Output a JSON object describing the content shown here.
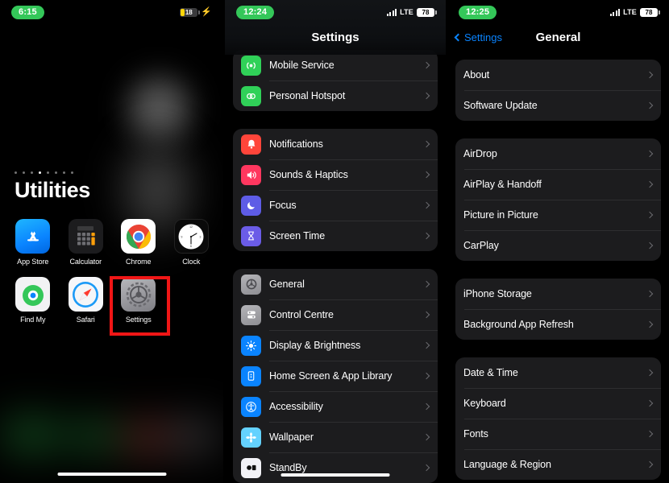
{
  "home": {
    "status": {
      "time": "6:15",
      "battery_percent": "18",
      "charging_icon": "lightning-bolt"
    },
    "folder_title": "Utilities",
    "page_dots": 8,
    "active_dot": 4,
    "apps": [
      {
        "label": "App Store",
        "icon": "app-store-icon"
      },
      {
        "label": "Calculator",
        "icon": "calculator-icon"
      },
      {
        "label": "Chrome",
        "icon": "chrome-icon"
      },
      {
        "label": "Clock",
        "icon": "clock-icon"
      },
      {
        "label": "Find My",
        "icon": "find-my-icon"
      },
      {
        "label": "Safari",
        "icon": "safari-icon"
      },
      {
        "label": "Settings",
        "icon": "settings-gear-icon"
      }
    ]
  },
  "settings": {
    "status": {
      "time": "12:24",
      "network": "LTE",
      "battery_percent": "78"
    },
    "title": "Settings",
    "groups": [
      {
        "rows": [
          {
            "label": "Mobile Service",
            "icon": "mobile-service-icon",
            "icon_color": "#30d158",
            "glyph": "((·))"
          },
          {
            "label": "Personal Hotspot",
            "icon": "personal-hotspot-icon",
            "icon_color": "#30d158",
            "glyph": "⚭"
          }
        ]
      },
      {
        "rows": [
          {
            "label": "Notifications",
            "icon": "notifications-icon",
            "icon_color": "#ff453a",
            "glyph": "🔔"
          },
          {
            "label": "Sounds & Haptics",
            "icon": "sounds-haptics-icon",
            "icon_color": "#ff375f",
            "glyph": "🔊"
          },
          {
            "label": "Focus",
            "icon": "focus-icon",
            "icon_color": "#5e5ce6",
            "glyph": "🌙"
          },
          {
            "label": "Screen Time",
            "icon": "screen-time-icon",
            "icon_color": "#6b5ce7",
            "glyph": "⌛"
          }
        ]
      },
      {
        "rows": [
          {
            "label": "General",
            "icon": "general-gear-icon",
            "icon_color": "#9a9a9f",
            "glyph": "⚙"
          },
          {
            "label": "Control Centre",
            "icon": "control-centre-icon",
            "icon_color": "#9a9a9f",
            "glyph": "☰"
          },
          {
            "label": "Display & Brightness",
            "icon": "display-brightness-icon",
            "icon_color": "#0a84ff",
            "glyph": "☀"
          },
          {
            "label": "Home Screen & App Library",
            "icon": "home-screen-icon",
            "icon_color": "#0a84ff",
            "glyph": "▤"
          },
          {
            "label": "Accessibility",
            "icon": "accessibility-icon",
            "icon_color": "#0a84ff",
            "glyph": "♿"
          },
          {
            "label": "Wallpaper",
            "icon": "wallpaper-icon",
            "icon_color": "#64d2ff",
            "glyph": "❀"
          },
          {
            "label": "StandBy",
            "icon": "standby-icon",
            "icon_color": "#f2f2f7",
            "glyph": "◑"
          }
        ]
      }
    ]
  },
  "general": {
    "status": {
      "time": "12:25",
      "network": "LTE",
      "battery_percent": "78"
    },
    "back_label": "Settings",
    "title": "General",
    "groups": [
      {
        "rows": [
          {
            "label": "About"
          },
          {
            "label": "Software Update"
          }
        ]
      },
      {
        "rows": [
          {
            "label": "AirDrop"
          },
          {
            "label": "AirPlay & Handoff"
          },
          {
            "label": "Picture in Picture"
          },
          {
            "label": "CarPlay"
          }
        ]
      },
      {
        "rows": [
          {
            "label": "iPhone Storage"
          },
          {
            "label": "Background App Refresh"
          }
        ]
      },
      {
        "rows": [
          {
            "label": "Date & Time"
          },
          {
            "label": "Keyboard"
          },
          {
            "label": "Fonts"
          },
          {
            "label": "Language & Region"
          }
        ]
      }
    ]
  },
  "highlights": {
    "color": "#f01616",
    "targets": [
      "Settings app icon",
      "General",
      "Software Update"
    ]
  }
}
